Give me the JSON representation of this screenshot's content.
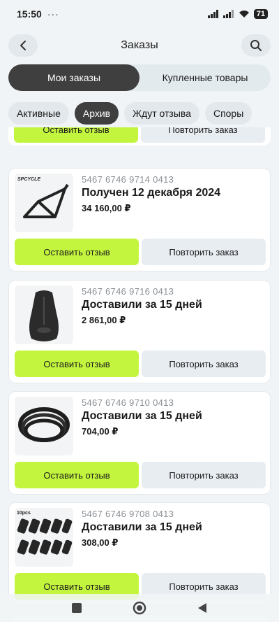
{
  "status_bar": {
    "time": "15:50",
    "dots": "···",
    "battery": "71"
  },
  "header": {
    "title": "Заказы"
  },
  "segments": [
    {
      "label": "Мои заказы",
      "active": true
    },
    {
      "label": "Купленные товары",
      "active": false
    }
  ],
  "chips": [
    {
      "label": "Активные",
      "active": false
    },
    {
      "label": "Архив",
      "active": true
    },
    {
      "label": "Ждут отзыва",
      "active": false
    },
    {
      "label": "Споры",
      "active": false
    }
  ],
  "actions": {
    "review": "Оставить отзыв",
    "repeat": "Повторить заказ"
  },
  "orders": [
    {
      "number": "5467 6746 9714 0413",
      "status": "Получен 12 декабря 2024",
      "price": "34 160,00 ₽",
      "thumb_icon": "bike-frame-icon",
      "brand": "SPCYCLE"
    },
    {
      "number": "5467 6746 9716 0413",
      "status": "Доставили за 15 дней",
      "price": "2 861,00 ₽",
      "thumb_icon": "bike-saddle-icon"
    },
    {
      "number": "5467 6746 9710 0413",
      "status": "Доставили за 15 дней",
      "price": "704,00 ₽",
      "thumb_icon": "inner-tube-icon"
    },
    {
      "number": "5467 6746 9708 0413",
      "status": "Доставили за 15 дней",
      "price": "308,00 ₽",
      "thumb_icon": "grips-set-icon",
      "badge": "10pcs"
    }
  ]
}
